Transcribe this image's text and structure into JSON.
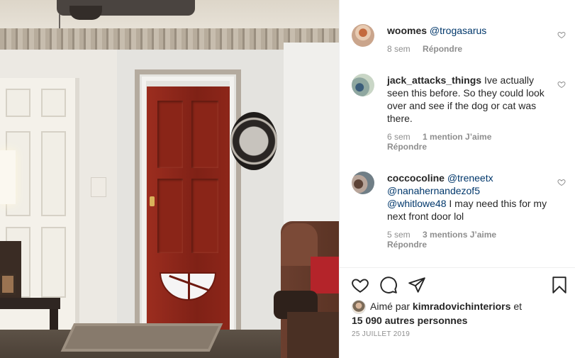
{
  "comments": [
    {
      "user": "woomes",
      "mentions": [
        "@trogasarus"
      ],
      "text": "",
      "time": "8 sem",
      "likes": "",
      "reply": "Répondre"
    },
    {
      "user": "jack_attacks_things",
      "mentions": [],
      "text": "Ive actually seen this before. So they could look over and see if the dog or cat was there.",
      "time": "6 sem",
      "likes": "1 mention J’aime",
      "reply": "Répondre"
    },
    {
      "user": "coccocoline",
      "mentions": [
        "@treneetx",
        "@nanahernandezof5",
        "@whitlowe48"
      ],
      "text": "I may need this for my next front door lol",
      "time": "5 sem",
      "likes": "3 mentions J’aime",
      "reply": "Répondre"
    }
  ],
  "liked_by": {
    "prefix": "Aimé par",
    "user": "kimradovichinteriors",
    "and": "et",
    "others": "15 090 autres personnes"
  },
  "date": "25 JUILLET 2019",
  "icons": [
    "heart-icon",
    "comment-icon",
    "share-icon",
    "bookmark-icon"
  ]
}
